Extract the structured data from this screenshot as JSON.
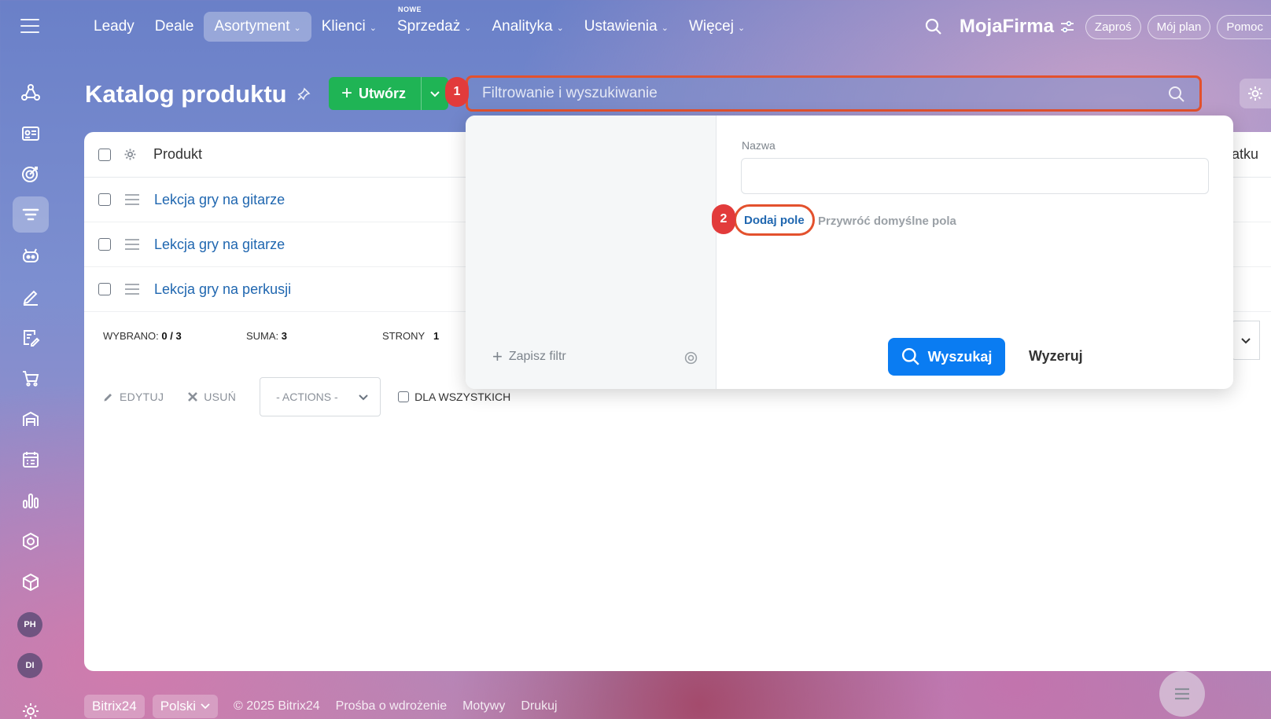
{
  "nav": {
    "items": [
      {
        "label": "Leady",
        "chevron": false,
        "active": false
      },
      {
        "label": "Deale",
        "chevron": false,
        "active": false
      },
      {
        "label": "Asortyment",
        "chevron": true,
        "active": true
      },
      {
        "label": "Klienci",
        "chevron": true,
        "active": false
      },
      {
        "label": "Sprzedaż",
        "chevron": true,
        "active": false,
        "badge": "NOWE"
      },
      {
        "label": "Analityka",
        "chevron": true,
        "active": false
      },
      {
        "label": "Ustawienia",
        "chevron": true,
        "active": false
      },
      {
        "label": "Więcej",
        "chevron": true,
        "active": false
      }
    ]
  },
  "header": {
    "brand": "MojaFirma",
    "invite": "Zaproś",
    "plan": "Mój plan",
    "help": "Pomoc"
  },
  "sidebar": {
    "icons": [
      "network-icon",
      "contact-card-icon",
      "target-icon",
      "funnel-icon",
      "robot-icon",
      "signature-icon",
      "document-edit-icon",
      "cart-icon",
      "warehouse-icon",
      "calendar-list-icon",
      "bar-chart-icon",
      "hexagon-icon",
      "box-icon"
    ],
    "avatars": [
      "PH",
      "DI"
    ]
  },
  "page": {
    "title": "Katalog produktu",
    "create_label": "Utwórz",
    "filter_placeholder": "Filtrowanie i wyszukiwanie"
  },
  "markers": {
    "one": "1",
    "two": "2"
  },
  "grid": {
    "column_product": "Produkt",
    "column_partial": "atku",
    "rows": [
      "Lekcja gry na gitarze",
      "Lekcja gry na gitarze",
      "Lekcja gry na perkusji"
    ],
    "selected_label": "WYBRANO:",
    "selected_value": "0 / 3",
    "sum_label": "SUMA:",
    "sum_value": "3",
    "pages_label": "STRONY",
    "pages_value": "1"
  },
  "actions": {
    "edit": "EDYTUJ",
    "delete": "USUŃ",
    "select": "- ACTIONS -",
    "for_all": "DLA WSZYSTKICH"
  },
  "filter_popup": {
    "field_label": "Nazwa",
    "field_value": "",
    "add_field": "Dodaj pole",
    "restore": "Przywróć domyślne pola",
    "save_filter": "Zapisz filtr",
    "search": "Wyszukaj",
    "reset": "Wyzeruj"
  },
  "footer": {
    "brand": "Bitrix24",
    "language": "Polski",
    "copyright": "© 2025 Bitrix24",
    "link1": "Prośba o wdrożenie",
    "link2": "Motywy",
    "link3": "Drukuj"
  },
  "colors": {
    "accent_green": "#1fb455",
    "accent_blue": "#0a7cf2",
    "highlight_red": "#e3512d",
    "marker_red": "#e23b3b",
    "link_blue": "#2067b0"
  }
}
